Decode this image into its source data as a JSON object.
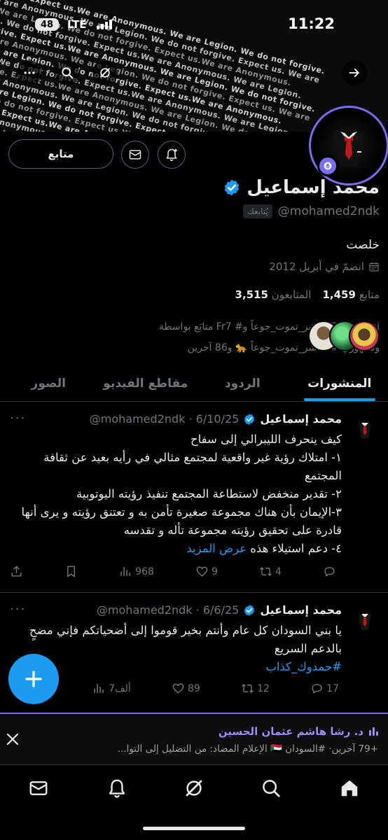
{
  "status": {
    "time": "11:22",
    "battery": "48",
    "network": "LTE"
  },
  "banner": {
    "lines": [
      "We do not forgive. Expect us.We are Anonymous. We are Legion. We do not forgive.",
      "Expect us.We are Anonymous. We are Legion. We do not forgive. Expect us. We are",
      "Anonymous. We are Legion. We do not forgive. Expect us.We are Anonymous.",
      "We are Legion. We do not forgive. Expect us.We are Anonymous. We are Legion.",
      "We do not forgive. Expect us.We are Anonymous. We are Legion. We do not forgive.",
      "Expect us.We are Anonymous. We are Legion. We do not forgive. Expect us. We are",
      "Anonymous. We are Legion. We do not forgive. Expect us.We are Anonymous.",
      "We are Legion. We do not forgive. Expect us.We are Anonymous. We are Legion.",
      "We do not forgive. Expect us.We are Anonymous. We are Legion. We do not forgive.",
      "Expect us.We are Anonymous. We are Legion. We do not forgive. Expect us. We are",
      "Anonymous. We are Legion. We do not forgive. Expect us.We are Anonymous.",
      "We are Legion. We do not forgive. Expect us.We are Anonymous. We are Legion.",
      "We do not forgive. Expect us.We are Anonymous. We are Legion. We do not forgive.",
      "Expect us.We are Anonymous. We are Legion. We do not forgive. Expect us. We are",
      "Anonymous. We are Legion. We do not forgive. Expect us.We are Anonymous.",
      "We are Legion. We do not forgive. Expect us.We are Anonymous. We are Legion.",
      "We do not forgive. Expect us.We are Anonymous. We are Legion. We do not forgive.",
      "Expect us.We are Anonymous. We are Legion. We do not forgive. Expect us. We are",
      "Anonymous. We are Legion. We do not forgive. Expect us.We are Anonymous."
    ]
  },
  "profile": {
    "follow_label": "متابع",
    "name": "محمد إسماعيل",
    "handle": "@mohamed2ndk",
    "follows_you": "يُتابعك",
    "bio": "خلصت",
    "joined": "انضمّ في أبريل 2012",
    "following_count": "1,459",
    "following_label": "متابع",
    "followers_count": "3,515",
    "followers_label": "المتابعون",
    "followed_by_line1": "متابَع بواسطة Fr7 #الفاشر_تموت_جوعاً وSafa Alhaj",
    "followed_by_line2": "وسنهوري #الفاشر_تموت_جوعاً 🐆 و86 آخرين"
  },
  "tabs": [
    {
      "label": "المنشورات",
      "active": true
    },
    {
      "label": "الردود",
      "active": false
    },
    {
      "label": "مقاطع الفيديو",
      "active": false
    },
    {
      "label": "الصور",
      "active": false
    }
  ],
  "posts": [
    {
      "name": "محمد إسماعيل",
      "meta": "@mohamed2ndk · 6/10/25",
      "lines": [
        "كيف ينحرف الليبرالي إلى سفاح",
        "١- امتلاك رؤية غير واقعية لمجتمع مثالي في رأيه بعيد عن ثقافة المجتمع",
        "٢- تقدير منخفض لاستطاعة المجتمع تنفيذ رؤيته اليوتوبية",
        "٣-الإيمان بأن هناك مجموعة صغيرة تأمن به و تعتنق رؤيته و يرى أنها قادرة على تحقيق رؤيته مجموعة تأله و تقدسه",
        "٤- دعم استيلاء هذه"
      ],
      "show_more": "عرض المزيد",
      "replies": "",
      "reposts": "4",
      "likes": "9",
      "views": "968"
    },
    {
      "name": "محمد إسماعيل",
      "meta": "@mohamed2ndk · 6/6/25",
      "lines": [
        "يا بني السودان كل عام وأنتم بخير قوموا إلى أضحياتكم فإني مضحٍ بالدعم السريع"
      ],
      "hashtag": "#حمدوك_كذاب",
      "replies": "17",
      "reposts": "12",
      "likes": "89",
      "views": "7ألف"
    }
  ],
  "spaces": {
    "title": "د. رشا هاشم عثمان الحسين",
    "subtitle": "+79 آخرين· #السودان 🇸🇩 الإعلام المضاد: من التضليل إلى التوا..."
  },
  "colors": {
    "accent": "#1d9bf0",
    "spaces": "#7b6cf0",
    "background": "#000000",
    "muted": "#71767b"
  }
}
